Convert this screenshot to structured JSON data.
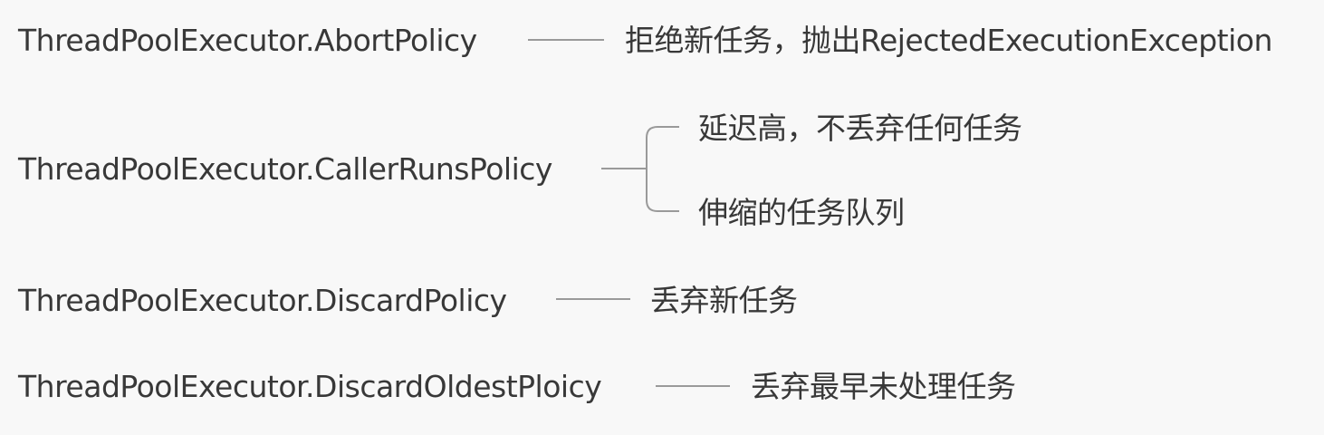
{
  "policies": [
    {
      "name": "ThreadPoolExecutor.AbortPolicy",
      "desc": "拒绝新任务，抛出RejectedExecutionException"
    },
    {
      "name": "ThreadPoolExecutor.CallerRunsPolicy",
      "descs": [
        "延迟高，不丢弃任何任务",
        "伸缩的任务队列"
      ]
    },
    {
      "name": "ThreadPoolExecutor.DiscardPolicy",
      "desc": "丢弃新任务"
    },
    {
      "name": "ThreadPoolExecutor.DiscardOldestPloicy",
      "desc": "丢弃最早未处理任务"
    }
  ],
  "colors": {
    "background": "#f8f8f8",
    "text": "#383838",
    "connector": "#9a9a9a"
  }
}
